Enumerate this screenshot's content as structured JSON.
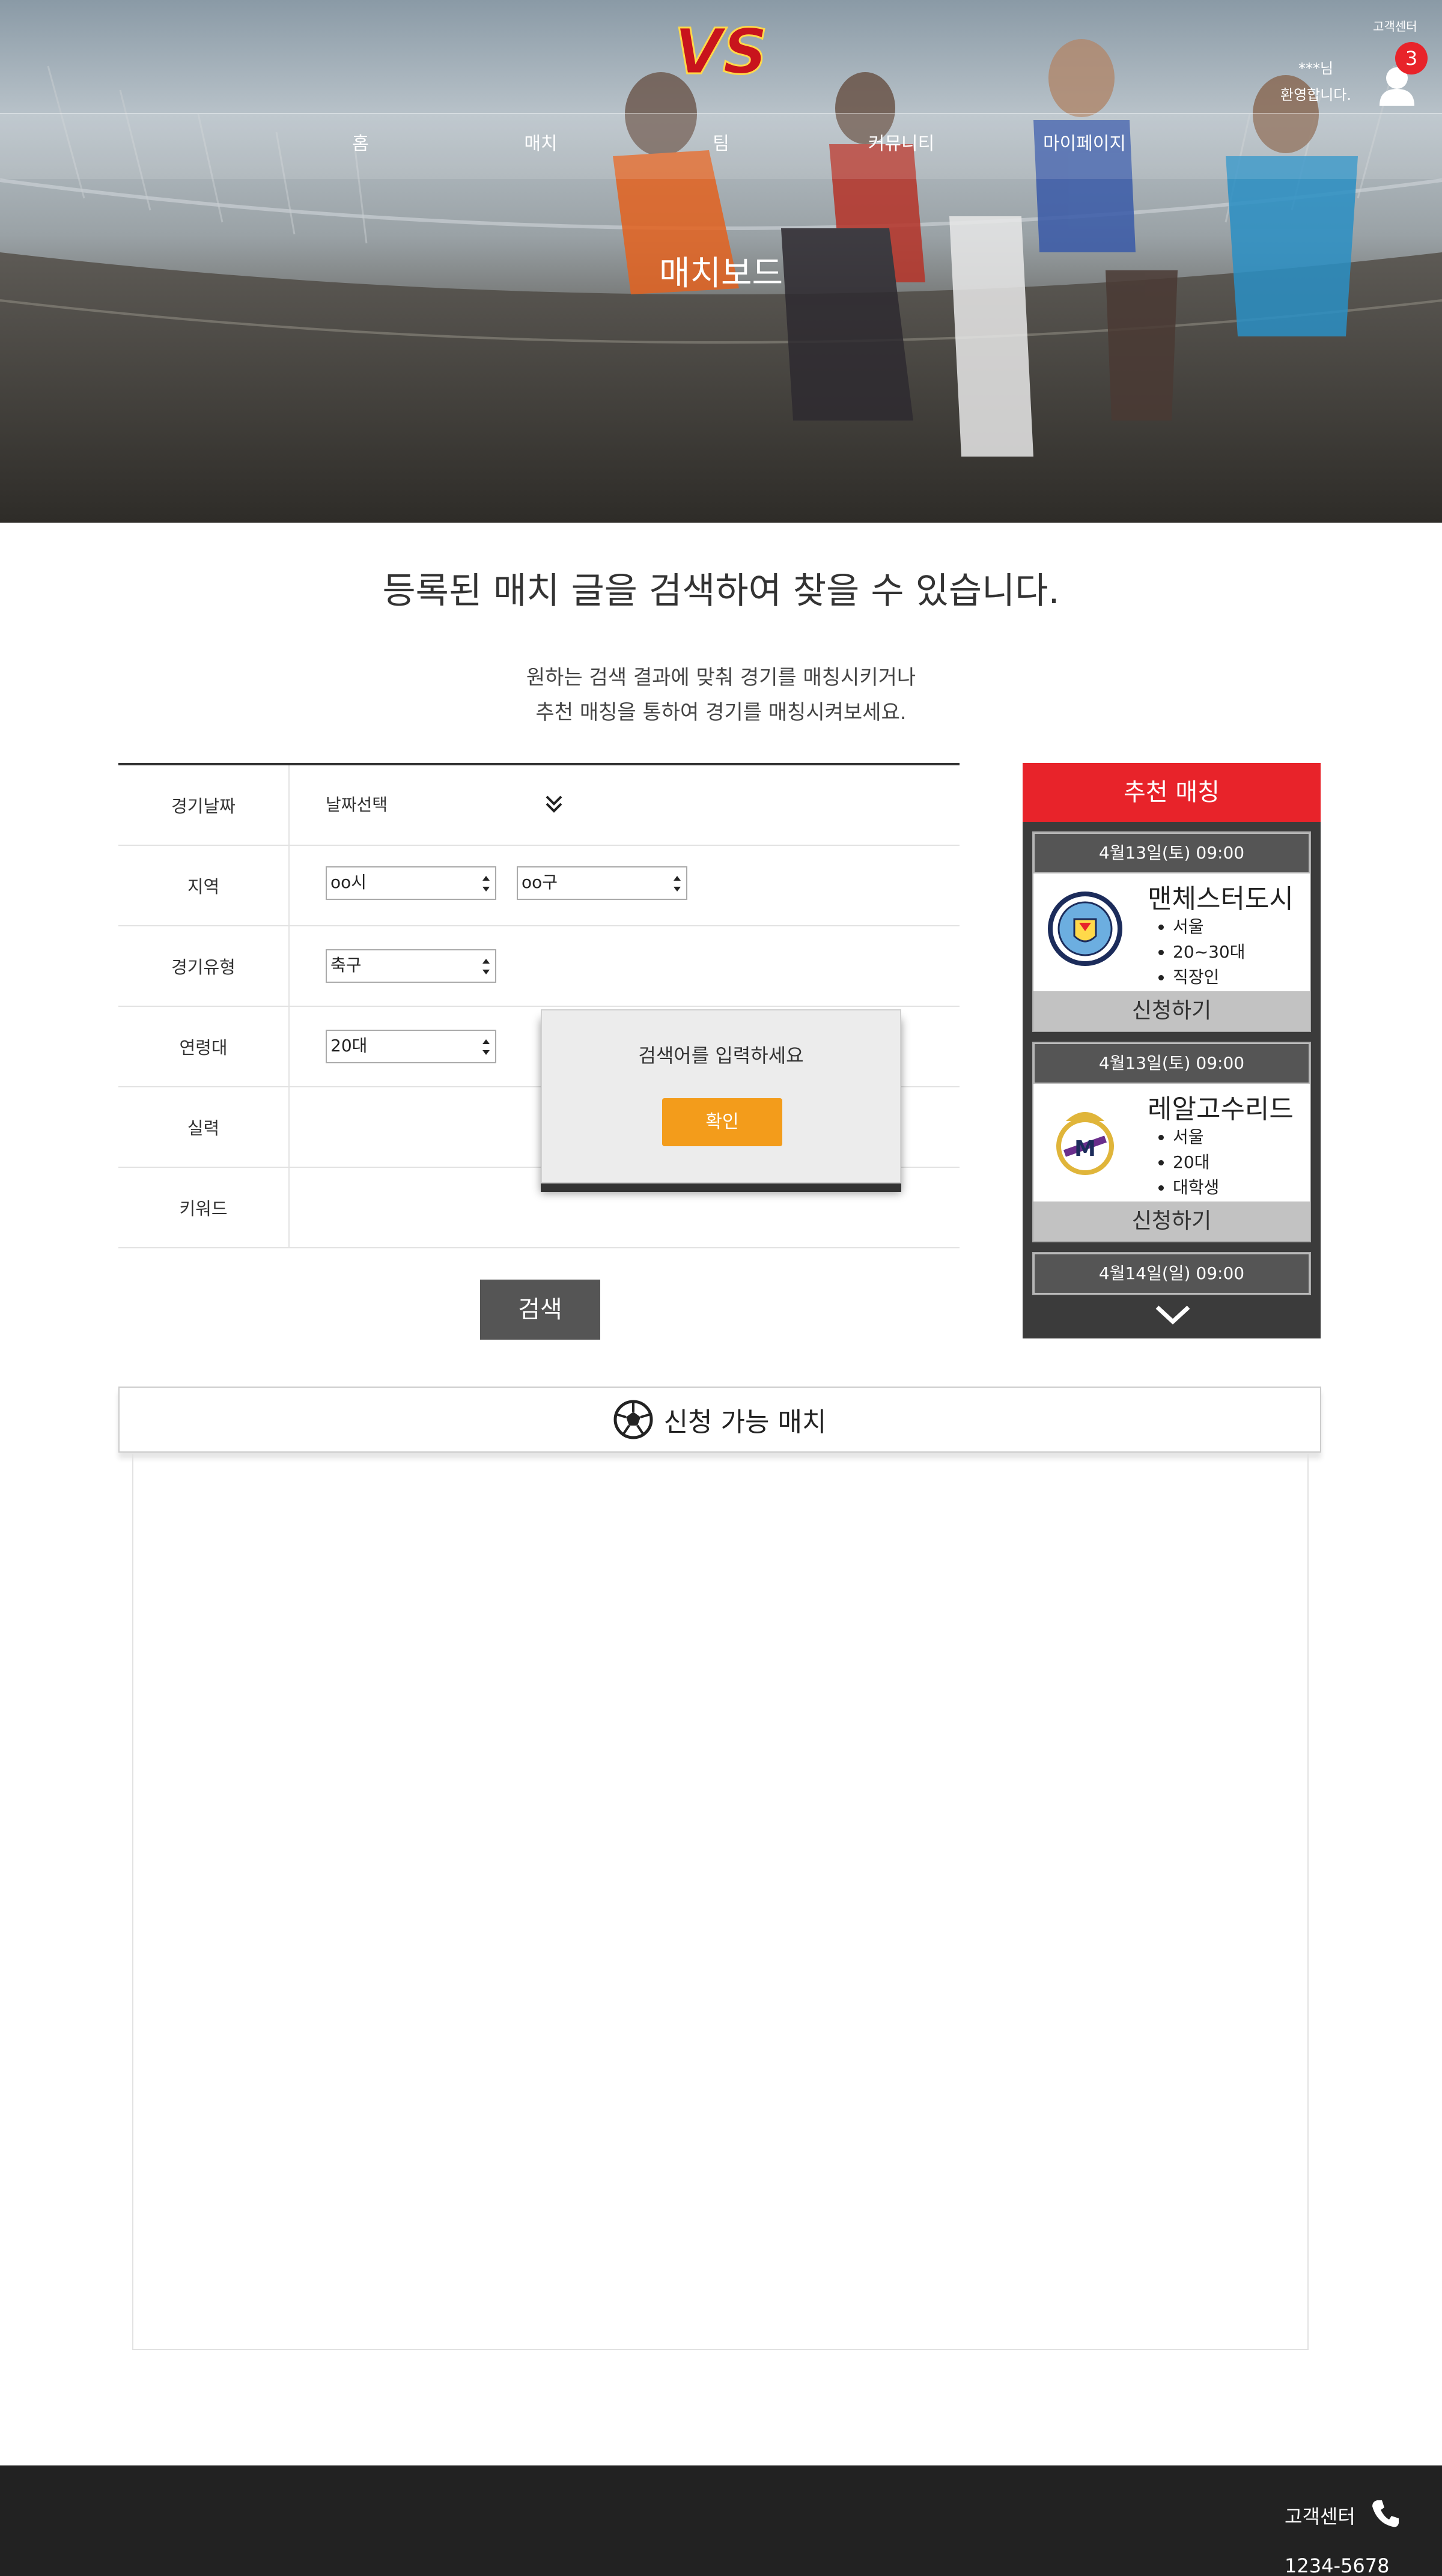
{
  "header": {
    "logo_text": "VS",
    "customer_center": "고객센터",
    "nav": [
      {
        "label": "홈"
      },
      {
        "label": "매치"
      },
      {
        "label": "팀"
      },
      {
        "label": "커뮤니티"
      },
      {
        "label": "마이페이지"
      }
    ],
    "user_line1": "***님",
    "user_line2": "환영합니다.",
    "notification_count": "3"
  },
  "hero": {
    "title": "매치보드"
  },
  "intro": {
    "headline": "등록된 매치 글을 검색하여 찾을 수 있습니다.",
    "desc_line1": "원하는 검색 결과에 맞춰 경기를 매칭시키거나",
    "desc_line2": "추천 매칭을 통하여 경기를 매칭시켜보세요."
  },
  "form": {
    "rows": [
      {
        "label": "경기날짜"
      },
      {
        "label": "지역"
      },
      {
        "label": "경기유형"
      },
      {
        "label": "연령대"
      },
      {
        "label": "실력"
      },
      {
        "label": "키워드"
      }
    ],
    "date_value": "날짜선택",
    "city_value": "oo시",
    "district_value": "oo구",
    "type_value": "축구",
    "age_value": "20대",
    "search_button": "검색"
  },
  "modal": {
    "message": "검색어를 입력하세요",
    "ok_button": "확인"
  },
  "recommend": {
    "title": "추천 매칭",
    "cards": [
      {
        "date": "4월13일(토) 09:00",
        "team": "맨체스터도시",
        "details": [
          "서울",
          "20~30대",
          "직장인"
        ],
        "apply": "신청하기"
      },
      {
        "date": "4월13일(토) 09:00",
        "team": "레알고수리드",
        "details": [
          "서울",
          "20대",
          "대학생"
        ],
        "apply": "신청하기"
      },
      {
        "date": "4월14일(일) 09:00"
      }
    ]
  },
  "available": {
    "title": "신청 가능 매치"
  },
  "footer": {
    "customer_center": "고객센터",
    "phone": "1234-5678"
  },
  "colors": {
    "accent_red": "#e8232a",
    "confirm_orange": "#f39c1b",
    "panel_dark": "#3b3b3b",
    "footer_bg": "#222222"
  }
}
